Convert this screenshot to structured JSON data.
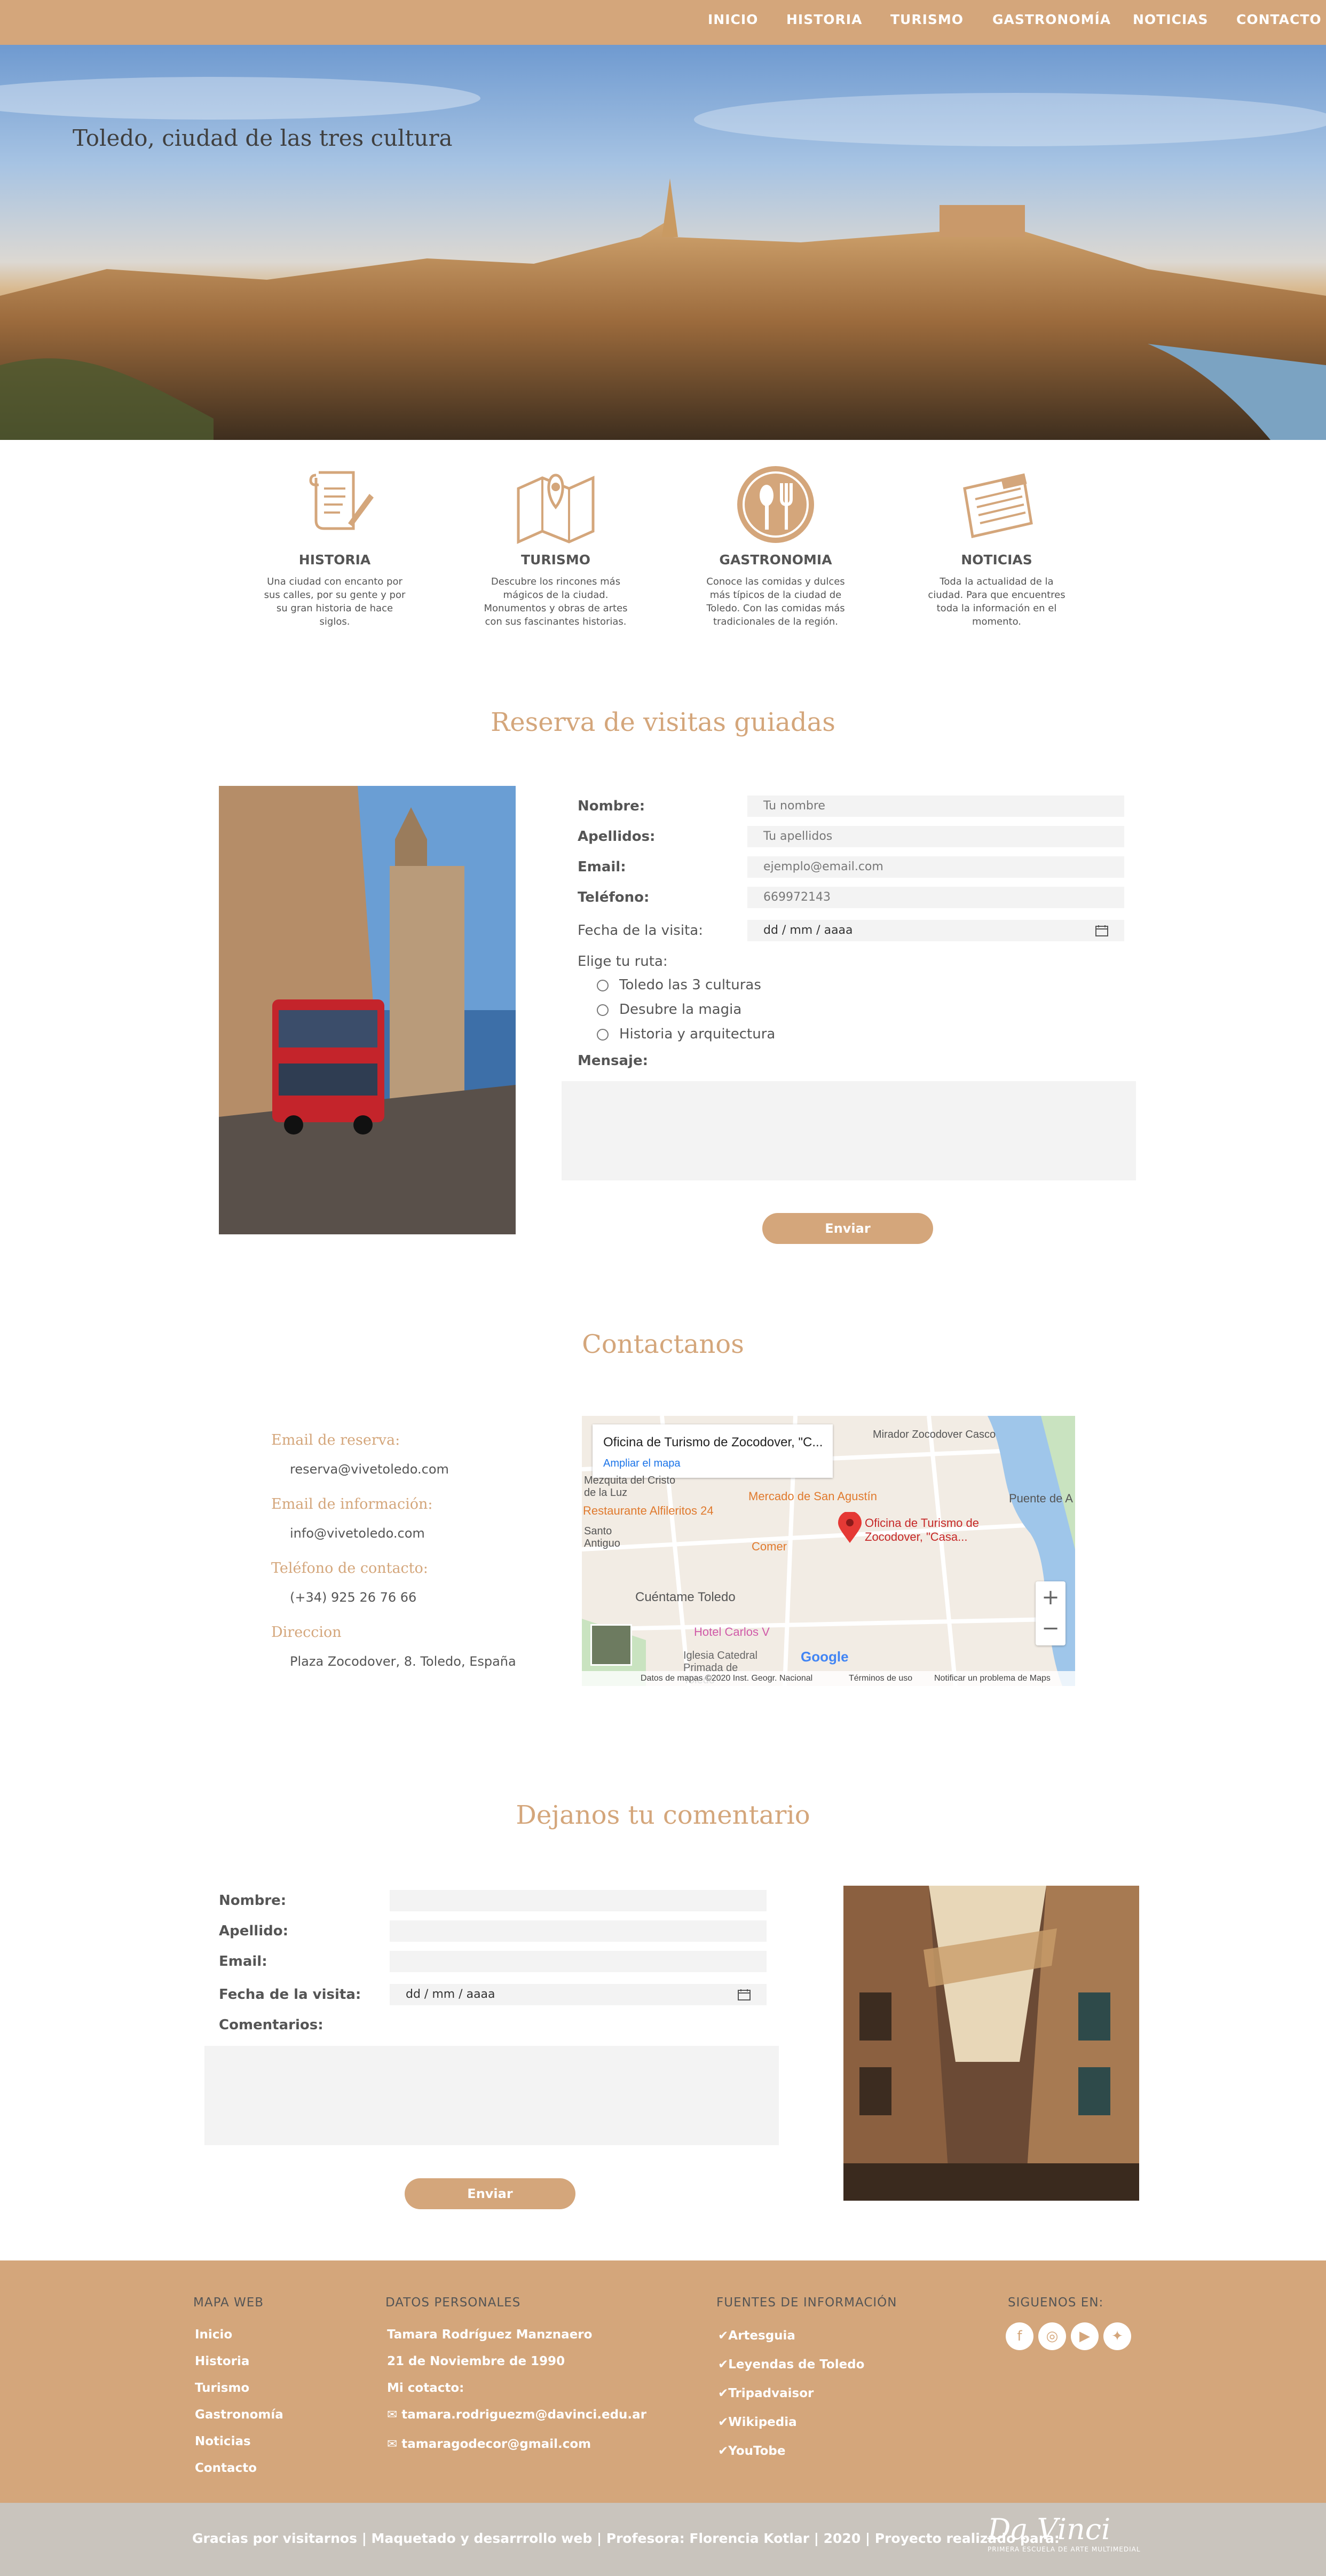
{
  "nav": {
    "items": [
      "INICIO",
      "HISTORIA",
      "TURISMO",
      "GASTRONOMÍA",
      "NOTICIAS",
      "CONTACTO"
    ]
  },
  "hero": {
    "title": "Toledo, ciudad de las tres cultura"
  },
  "features": [
    {
      "icon": "scroll-icon",
      "title": "HISTORIA",
      "desc": "Una ciudad con encanto por sus calles, por su gente y por su gran historia de hace siglos."
    },
    {
      "icon": "map-icon",
      "title": "TURISMO",
      "desc": "Descubre los rincones más mágicos de la ciudad. Monumentos y obras de artes con sus fascinantes historias."
    },
    {
      "icon": "cutlery-icon",
      "title": "GASTRONOMIA",
      "desc": "Conoce las comidas y dulces más típicos de la ciudad de Toledo. Con las comidas más tradicionales de la región."
    },
    {
      "icon": "newspaper-icon",
      "title": "NOTICIAS",
      "desc": "Toda la actualidad de la ciudad. Para que encuentres toda la información en el momento."
    }
  ],
  "reserva": {
    "title": "Reserva de visitas guiadas",
    "labels": {
      "nombre": "Nombre:",
      "apellidos": "Apellidos:",
      "email": "Email:",
      "telefono": "Teléfono:",
      "fecha": "Fecha de la visita:",
      "ruta": "Elige tu ruta:",
      "mensaje": "Mensaje:"
    },
    "placeholders": {
      "nombre": "Tu nombre",
      "apellidos": "Tu apellidos",
      "email": "ejemplo@email.com",
      "telefono": "669972143",
      "fecha": "dd / mm / aaaa"
    },
    "routes": [
      "Toledo las 3 culturas",
      "Desubre la magia",
      "Historia y arquitectura"
    ],
    "submit": "Enviar"
  },
  "contacto": {
    "title": "Contactanos",
    "items": [
      {
        "heading": "Email de reserva:",
        "value": "reserva@vivetoledo.com"
      },
      {
        "heading": "Email de información:",
        "value": "info@vivetoledo.com"
      },
      {
        "heading": "Teléfono de contacto:",
        "value": "(+34) 925 26 76 66"
      },
      {
        "heading": "Direccion",
        "value": "Plaza Zocodover, 8. Toledo, España"
      }
    ],
    "map": {
      "card_title": "Oficina de Turismo de Zocodover, \"C...",
      "card_link": "Ampliar el mapa",
      "pin_label": "Oficina de Turismo de Zocodover, \"Casa...",
      "places": [
        "Mercado de San Agustín",
        "Restaurante Alfileritos 24",
        "Comer",
        "Cuéntame Toledo",
        "Hotel Carlos V",
        "Iglesia Catedral Primada de Toledo",
        "Puente de A",
        "Mezquita del Cristo de la Luz",
        "Santo Antiguo",
        "Mirador Zocodover Casco"
      ],
      "footer": [
        "Datos de mapas ©2020 Inst. Geogr. Nacional",
        "Términos de uso",
        "Notificar un problema de Maps"
      ],
      "logo": "Google"
    }
  },
  "comentario": {
    "title": "Dejanos tu comentario",
    "labels": {
      "nombre": "Nombre:",
      "apellido": "Apellido:",
      "email": "Email:",
      "fecha": "Fecha de la visita:",
      "comentarios": "Comentarios:"
    },
    "fecha_placeholder": "dd / mm / aaaa",
    "submit": "Enviar"
  },
  "footer": {
    "mapa": {
      "heading": "MAPA WEB",
      "items": [
        "Inicio",
        "Historia",
        "Turismo",
        "Gastronomía",
        "Noticias",
        "Contacto"
      ]
    },
    "datos": {
      "heading": "DATOS PERSONALES",
      "items": [
        "Tamara Rodríguez Manznaero",
        "21 de Noviembre de 1990",
        "Mi cotacto:",
        "tamara.rodriguezm@davinci.edu.ar",
        "tamaragodecor@gmail.com"
      ]
    },
    "fuentes": {
      "heading": "FUENTES DE INFORMACIÓN",
      "items": [
        "Artesguia",
        "Leyendas de Toledo",
        "Tripadvaisor",
        "Wikipedia",
        "YouTobe"
      ]
    },
    "siguenos": {
      "heading": "SIGUENOS EN:",
      "icons": [
        "facebook-icon",
        "instagram-icon",
        "youtube-icon",
        "twitter-icon"
      ]
    },
    "bottom": "Gracias por visitarnos | Maquetado y desarrrollo web | Profesora: Florencia Kotlar | 2020 | Proyecto realizado para:",
    "logo_main": "Da Vinci",
    "logo_sub": "PRIMERA ESCUELA DE ARTE MULTIMEDIAL"
  }
}
